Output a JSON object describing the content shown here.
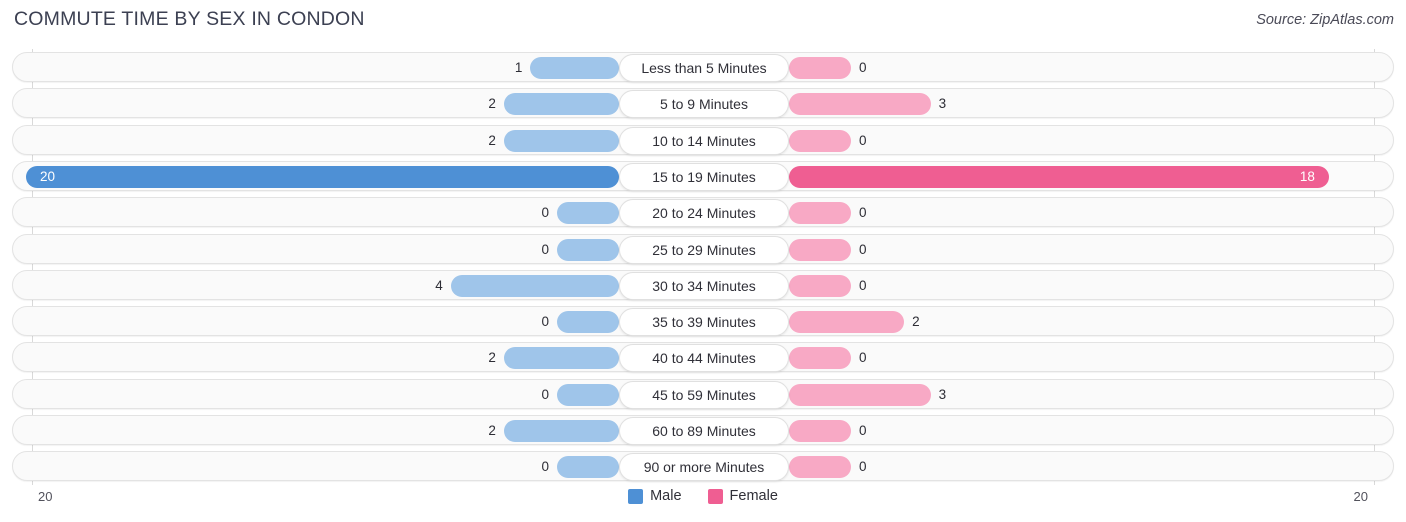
{
  "header": {
    "title": "COMMUTE TIME BY SEX IN CONDON",
    "source": "Source: ZipAtlas.com"
  },
  "axis": {
    "left_tick": "20",
    "right_tick": "20"
  },
  "legend": {
    "items": [
      {
        "label": "Male",
        "color": "#4e90d5"
      },
      {
        "label": "Female",
        "color": "#ef5e92"
      }
    ]
  },
  "colors": {
    "male": "#9fc5ea",
    "female": "#f8a9c5",
    "male_highlight": "#4e90d5",
    "female_highlight": "#ef5e92",
    "row_background": "#fafafa",
    "row_border": "#e3e3e3"
  },
  "chart_data": {
    "type": "bar",
    "title": "COMMUTE TIME BY SEX IN CONDON",
    "subtitle": "",
    "xlabel": "",
    "ylabel": "",
    "orientation": "horizontal-diverging",
    "grid": false,
    "legend_position": "bottom-center",
    "axis_max": 20,
    "xlim": [
      20,
      20
    ],
    "categories": [
      "Less than 5 Minutes",
      "5 to 9 Minutes",
      "10 to 14 Minutes",
      "15 to 19 Minutes",
      "20 to 24 Minutes",
      "25 to 29 Minutes",
      "30 to 34 Minutes",
      "35 to 39 Minutes",
      "40 to 44 Minutes",
      "45 to 59 Minutes",
      "60 to 89 Minutes",
      "90 or more Minutes"
    ],
    "series": [
      {
        "name": "Male",
        "color": "#9fc5ea",
        "values": [
          1,
          2,
          2,
          20,
          0,
          0,
          4,
          0,
          2,
          0,
          2,
          0
        ]
      },
      {
        "name": "Female",
        "color": "#f8a9c5",
        "values": [
          0,
          3,
          0,
          18,
          0,
          0,
          0,
          2,
          0,
          3,
          0,
          0
        ]
      }
    ],
    "highlighted_category": "15 to 19 Minutes"
  },
  "rows": [
    {
      "category": "Less than 5 Minutes",
      "male": "1",
      "female": "0",
      "highlight": false
    },
    {
      "category": "5 to 9 Minutes",
      "male": "2",
      "female": "3",
      "highlight": false
    },
    {
      "category": "10 to 14 Minutes",
      "male": "2",
      "female": "0",
      "highlight": false
    },
    {
      "category": "15 to 19 Minutes",
      "male": "20",
      "female": "18",
      "highlight": true
    },
    {
      "category": "20 to 24 Minutes",
      "male": "0",
      "female": "0",
      "highlight": false
    },
    {
      "category": "25 to 29 Minutes",
      "male": "0",
      "female": "0",
      "highlight": false
    },
    {
      "category": "30 to 34 Minutes",
      "male": "4",
      "female": "0",
      "highlight": false
    },
    {
      "category": "35 to 39 Minutes",
      "male": "0",
      "female": "2",
      "highlight": false
    },
    {
      "category": "40 to 44 Minutes",
      "male": "2",
      "female": "0",
      "highlight": false
    },
    {
      "category": "45 to 59 Minutes",
      "male": "0",
      "female": "3",
      "highlight": false
    },
    {
      "category": "60 to 89 Minutes",
      "male": "2",
      "female": "0",
      "highlight": false
    },
    {
      "category": "90 or more Minutes",
      "male": "0",
      "female": "0",
      "highlight": false
    }
  ]
}
